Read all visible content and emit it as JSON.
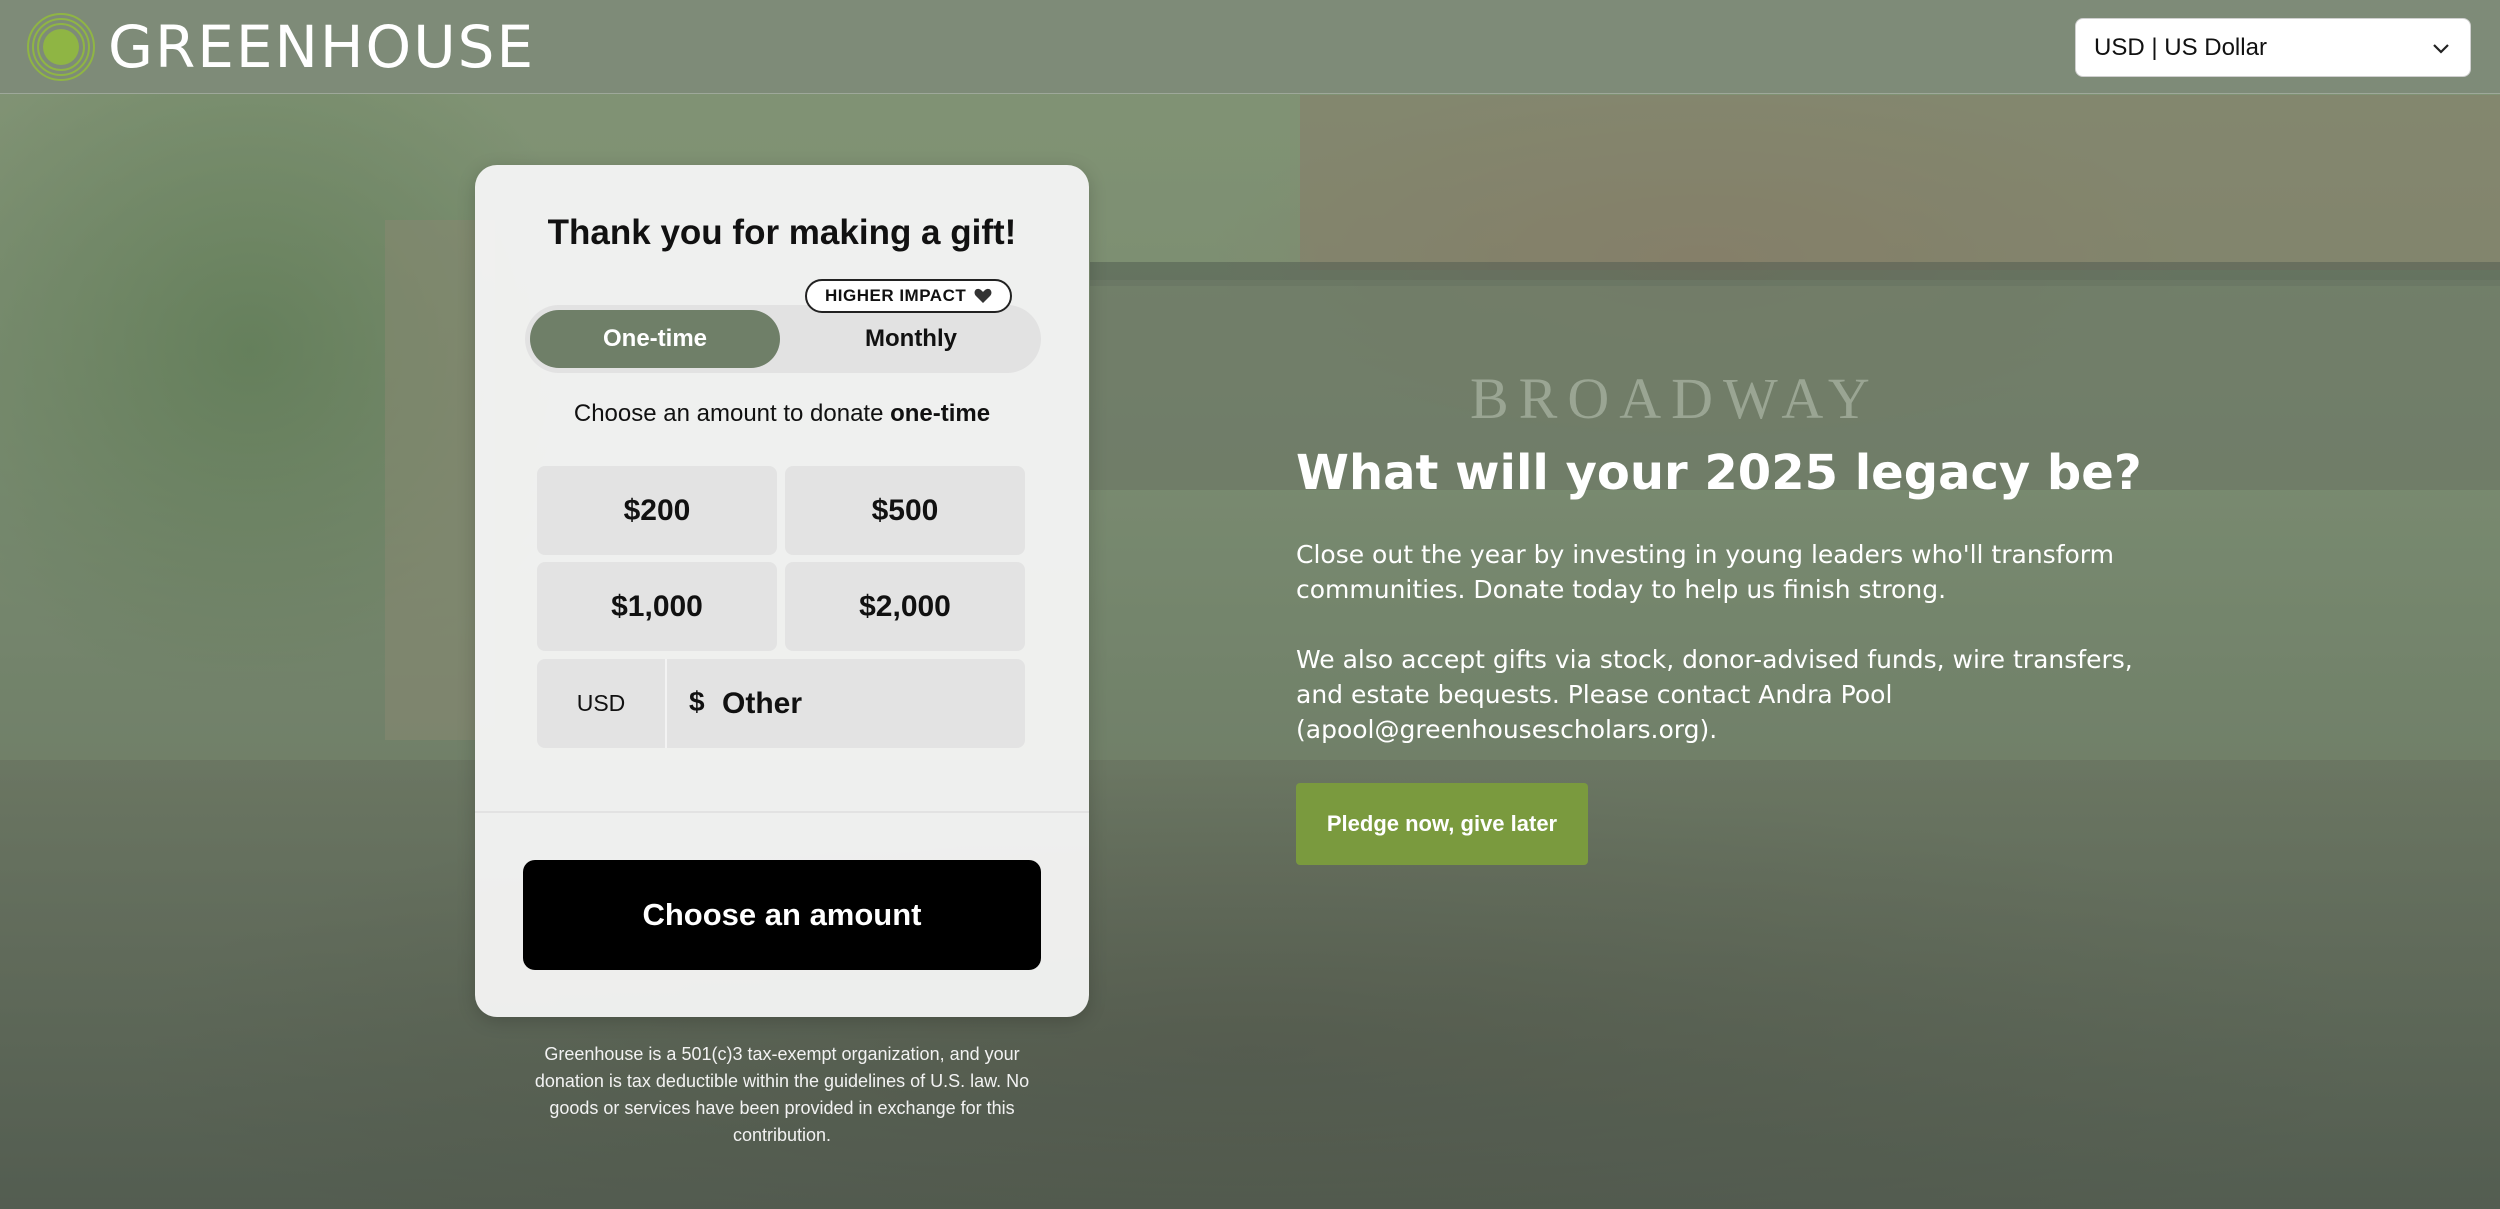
{
  "header": {
    "logo_text": "GREENHOUSE",
    "currency_select": {
      "value": "USD | US Dollar",
      "icon": "chevron-down-icon"
    }
  },
  "background": {
    "bridge_text": "BROADWAY"
  },
  "donation_card": {
    "title": "Thank you for making a gift!",
    "frequency": {
      "selected": "One-time",
      "options": [
        "One-time",
        "Monthly"
      ],
      "badge": {
        "label": "HIGHER IMPACT",
        "icon": "heart-icon"
      }
    },
    "choose_prefix": "Choose an amount to donate ",
    "choose_emphasis": "one-time",
    "amounts": [
      "$200",
      "$500",
      "$1,000",
      "$2,000"
    ],
    "other": {
      "currency": "USD",
      "symbol": "$",
      "placeholder": "Other"
    },
    "submit_label": "Choose an amount"
  },
  "disclaimer": "Greenhouse is a 501(c)3 tax-exempt organization, and your donation is tax deductible within the guidelines of U.S. law. No goods or services have been provided in exchange for this contribution.",
  "legacy": {
    "title": "What will your 2025 legacy be?",
    "paragraph1": "Close out the year by investing in young leaders who'll transform communities. Donate today to help us finish strong.",
    "paragraph2": "We also accept gifts via stock, donor-advised funds, wire transfers, and estate bequests. Please contact Andra Pool (apool@greenhousescholars.org).",
    "pledge_label": "Pledge now, give later"
  },
  "colors": {
    "header_bg": "#7e8b78",
    "toggle_active": "#6f7f68",
    "pledge_button": "#7a9a3e",
    "submit_button": "#000000"
  }
}
